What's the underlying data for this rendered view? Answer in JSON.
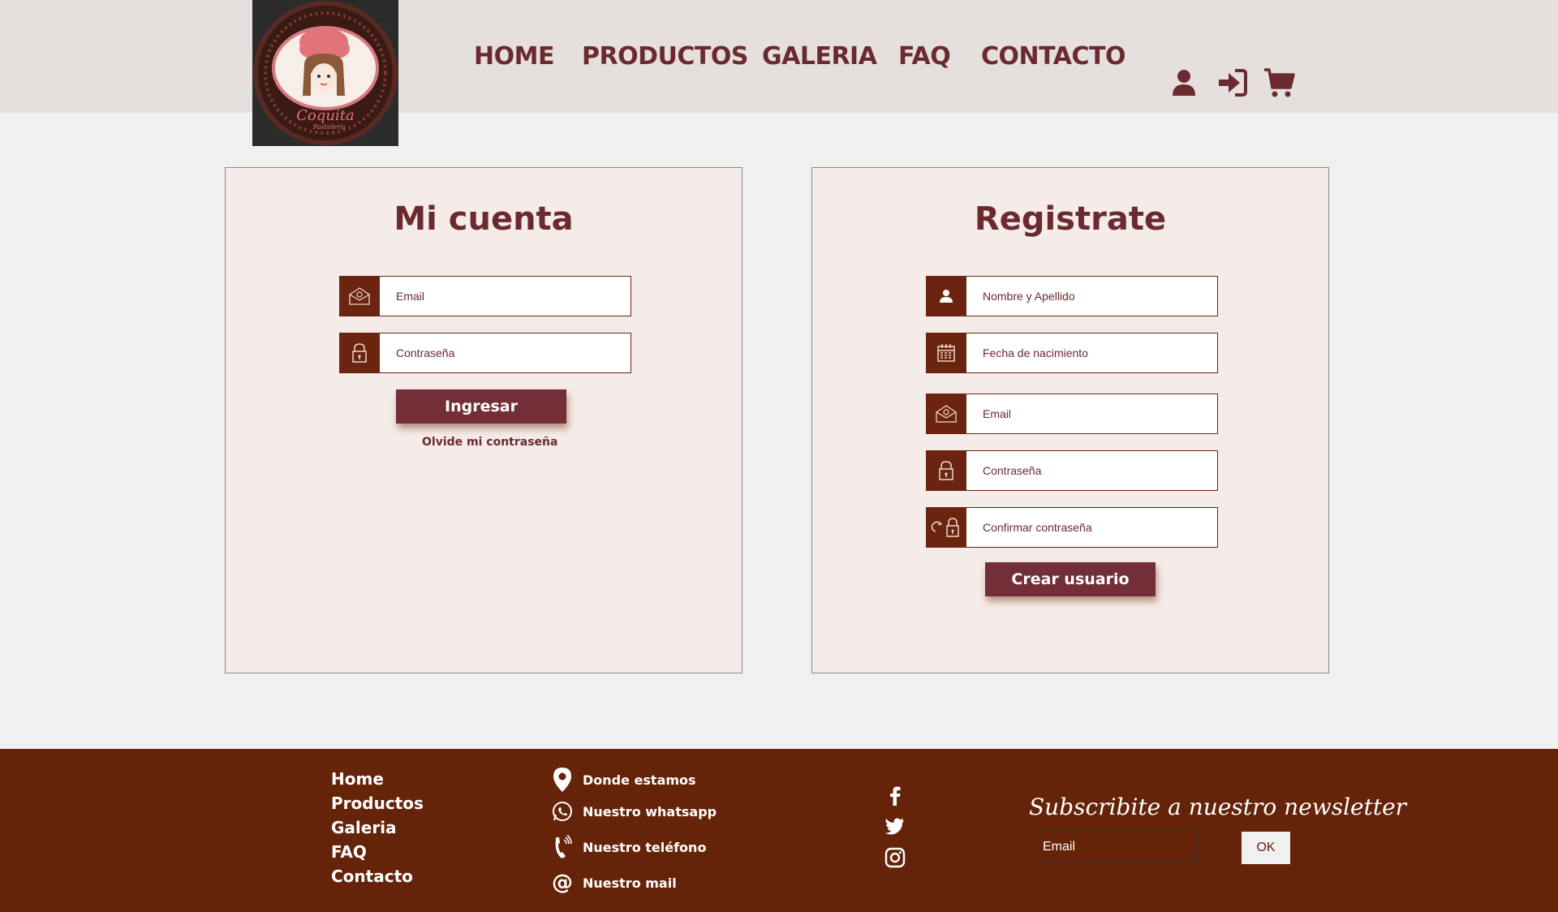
{
  "brand": {
    "logo_icon": "chef-girl-logo-icon",
    "logo_text": "Coquita",
    "logo_subtext": "Pastelería"
  },
  "nav": {
    "items": [
      "HOME",
      "PRODUCTOS",
      "GALERIA",
      "FAQ",
      "CONTACTO"
    ]
  },
  "header_icons": [
    "user-icon",
    "sign-in-icon",
    "cart-icon"
  ],
  "login": {
    "title": "Mi cuenta",
    "email_placeholder": "Email",
    "password_placeholder": "Contraseña",
    "submit_label": "Ingresar",
    "forgot_label": "Olvide mi contraseña"
  },
  "register": {
    "title": "Registrate",
    "name_placeholder": "Nombre y Apellido",
    "birthdate_placeholder": "Fecha de nacimiento",
    "email_placeholder": "Email",
    "password_placeholder": "Contraseña",
    "confirm_placeholder": "Confirmar contraseña",
    "submit_label": "Crear usuario"
  },
  "footer": {
    "nav": [
      "Home",
      "Productos",
      "Galeria",
      "FAQ",
      "Contacto"
    ],
    "contact": [
      {
        "icon": "location-pin-icon",
        "label": "Donde estamos"
      },
      {
        "icon": "whatsapp-icon",
        "label": "Nuestro whatsapp"
      },
      {
        "icon": "phone-icon",
        "label": "Nuestro teléfono"
      },
      {
        "icon": "at-icon",
        "label": "Nuestro mail"
      }
    ],
    "social": [
      "facebook-icon",
      "twitter-icon",
      "instagram-icon"
    ],
    "newsletter": {
      "title": "Subscribite a nuestro newsletter",
      "placeholder": "Email",
      "button": "OK"
    }
  },
  "colors": {
    "primary": "#6b2a2f",
    "button": "#722f37",
    "footer": "#652309",
    "header": "#e5e0dd",
    "card": "#f5ebe8"
  }
}
